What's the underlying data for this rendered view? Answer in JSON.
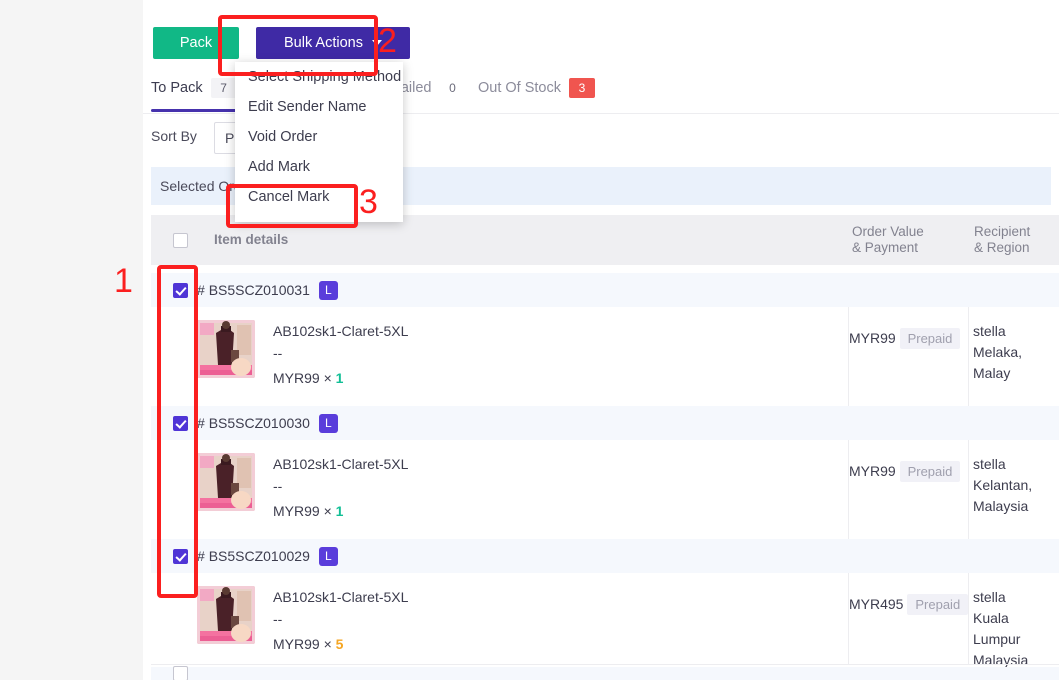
{
  "toolbar": {
    "pack_label": "Pack",
    "bulk_actions_label": "Bulk Actions",
    "caret_icon": "chevron-down-icon"
  },
  "tabs": [
    {
      "label": "To Pack",
      "count": "7",
      "active": true
    },
    {
      "label": "Failed",
      "count": "0",
      "active": false
    },
    {
      "label": "Out Of Stock",
      "count": "3",
      "active": false,
      "alert": true
    }
  ],
  "sort": {
    "label": "Sort By",
    "value": "Paid"
  },
  "selected_banner": {
    "text": "Selected Ord"
  },
  "table": {
    "headers": {
      "item_details": "Item details",
      "order_value": "Order Value",
      "order_payment": "& Payment",
      "recipient": "Recipient",
      "region": "& Region"
    },
    "rows": [
      {
        "checked": true,
        "hash": "#",
        "order_id": "BS5SCZ010031",
        "size_badge": "L",
        "item_name": "AB102sk1-Claret-5XL",
        "item_variant": "--",
        "item_price": "MYR99",
        "qty_sep": "×",
        "qty": "1",
        "qty_color": "#12bf96",
        "order_value": "MYR99",
        "payment": "Prepaid",
        "recipient": "stella",
        "region": "Melaka, Malay"
      },
      {
        "checked": true,
        "hash": "#",
        "order_id": "BS5SCZ010030",
        "size_badge": "L",
        "item_name": "AB102sk1-Claret-5XL",
        "item_variant": "--",
        "item_price": "MYR99",
        "qty_sep": "×",
        "qty": "1",
        "qty_color": "#12bf96",
        "order_value": "MYR99",
        "payment": "Prepaid",
        "recipient": "stella",
        "region": "Kelantan,\nMalaysia"
      },
      {
        "checked": true,
        "hash": "#",
        "order_id": "BS5SCZ010029",
        "size_badge": "L",
        "item_name": "AB102sk1-Claret-5XL",
        "item_variant": "--",
        "item_price": "MYR99",
        "qty_sep": "×",
        "qty": "5",
        "qty_color": "#f5a623",
        "order_value": "MYR495",
        "payment": "Prepaid",
        "recipient": "stella",
        "region": "Kuala Lumpur\nMalaysia"
      }
    ]
  },
  "dropdown": {
    "items": [
      "Select Shipping Method",
      "Edit Sender Name",
      "Void Order",
      "Add Mark",
      "Cancel Mark"
    ]
  },
  "annotations": [
    {
      "number": "1"
    },
    {
      "number": "2"
    },
    {
      "number": "3"
    }
  ],
  "colors": {
    "pack_button": "#11b886",
    "bulk_button": "#3f2aa5",
    "tab_underline": "#4632ad",
    "alert_badge": "#f0554f",
    "checkbox_checked": "#4f35d6",
    "annotation": "#fb1f1f",
    "selected_banner": "#eaf1fb"
  }
}
